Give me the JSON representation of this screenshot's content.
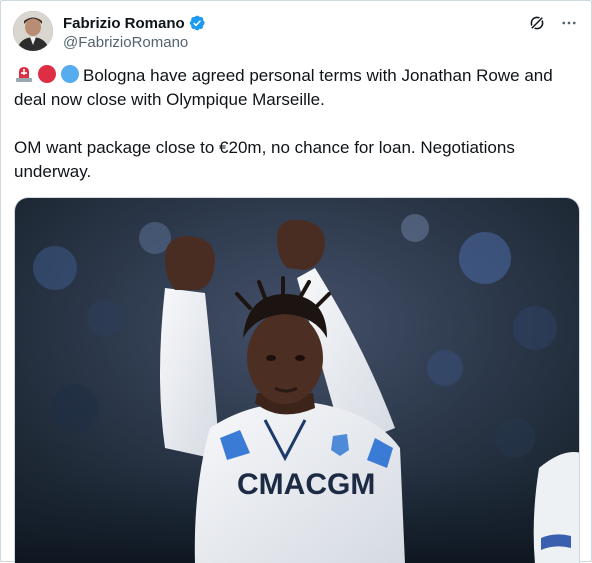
{
  "author": {
    "display_name": "Fabrizio Romano",
    "handle": "@FabrizioRomano",
    "verified": true,
    "avatar_icon": "profile-photo",
    "verified_color": "#1d9bf0"
  },
  "actions": {
    "grok_icon": "grok-slash-icon",
    "more_icon": "more-horizontal-icon"
  },
  "tweet": {
    "emoji": [
      "police-light",
      "red-circle",
      "blue-circle"
    ],
    "paragraph_1": "Bologna have agreed personal terms with Jonathan Rowe and deal now close with Olympique Marseille.",
    "paragraph_2": "OM want package close to €20m, no chance for loan. Negotiations underway."
  },
  "media": {
    "type": "photo",
    "shirt_sponsor": "CMACGM"
  }
}
